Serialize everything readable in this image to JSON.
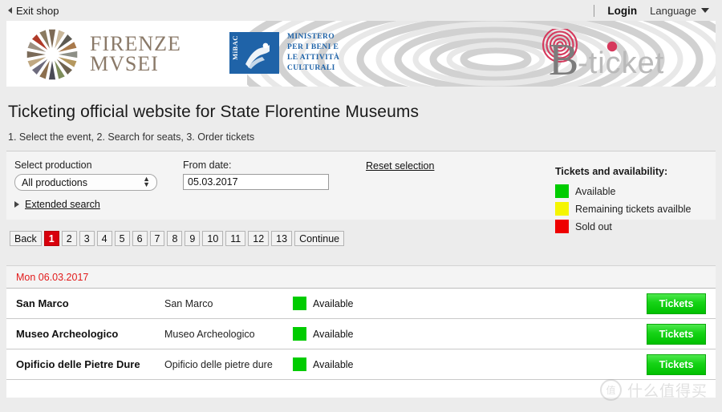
{
  "topbar": {
    "exit_label": "Exit shop",
    "login_label": "Login",
    "language_label": "Language"
  },
  "header": {
    "firenze_line1": "FIRENZE",
    "firenze_line2": "MVSEI",
    "mibac_badge": "MiBAC",
    "mibac_line1": "MINISTERO",
    "mibac_line2": "PER I BENI E",
    "mibac_line3": "LE ATTIVITÀ",
    "mibac_line4": "CULTURALI",
    "bticket_b": "B",
    "bticket_rest": "-ticket"
  },
  "main": {
    "title": "Ticketing official website for State Florentine Museums",
    "steps": "1. Select the event, 2. Search for seats, 3. Order tickets"
  },
  "form": {
    "production_label": "Select production",
    "production_value": "All productions",
    "production_options": [
      "All productions"
    ],
    "date_label": "From date:",
    "date_value": "05.03.2017",
    "reset_label": "Reset selection",
    "extended_label": "Extended search"
  },
  "pager": {
    "back_label": "Back",
    "continue_label": "Continue",
    "pages": [
      "1",
      "2",
      "3",
      "4",
      "5",
      "6",
      "7",
      "8",
      "9",
      "10",
      "11",
      "12",
      "13"
    ],
    "active_page": "1"
  },
  "legend": {
    "title": "Tickets and availability:",
    "items": [
      {
        "label": "Available",
        "color": "#00cc00",
        "swatch": "sw-green"
      },
      {
        "label": "Remaining tickets availble",
        "color": "#f5f500",
        "swatch": "sw-yellow"
      },
      {
        "label": "Sold out",
        "color": "#ee0000",
        "swatch": "sw-red"
      }
    ]
  },
  "results": {
    "date_header": "Mon 06.03.2017",
    "rows": [
      {
        "name": "San Marco",
        "venue": "San Marco",
        "status": "Available",
        "swatch": "sw-green",
        "button": "Tickets"
      },
      {
        "name": "Museo Archeologico",
        "venue": "Museo Archeologico",
        "status": "Available",
        "swatch": "sw-green",
        "button": "Tickets"
      },
      {
        "name": "Opificio delle Pietre Dure",
        "venue": "Opificio delle pietre dure",
        "status": "Available",
        "swatch": "sw-green",
        "button": "Tickets"
      }
    ]
  },
  "watermark": {
    "mark": "值",
    "text": "什么值得买"
  }
}
